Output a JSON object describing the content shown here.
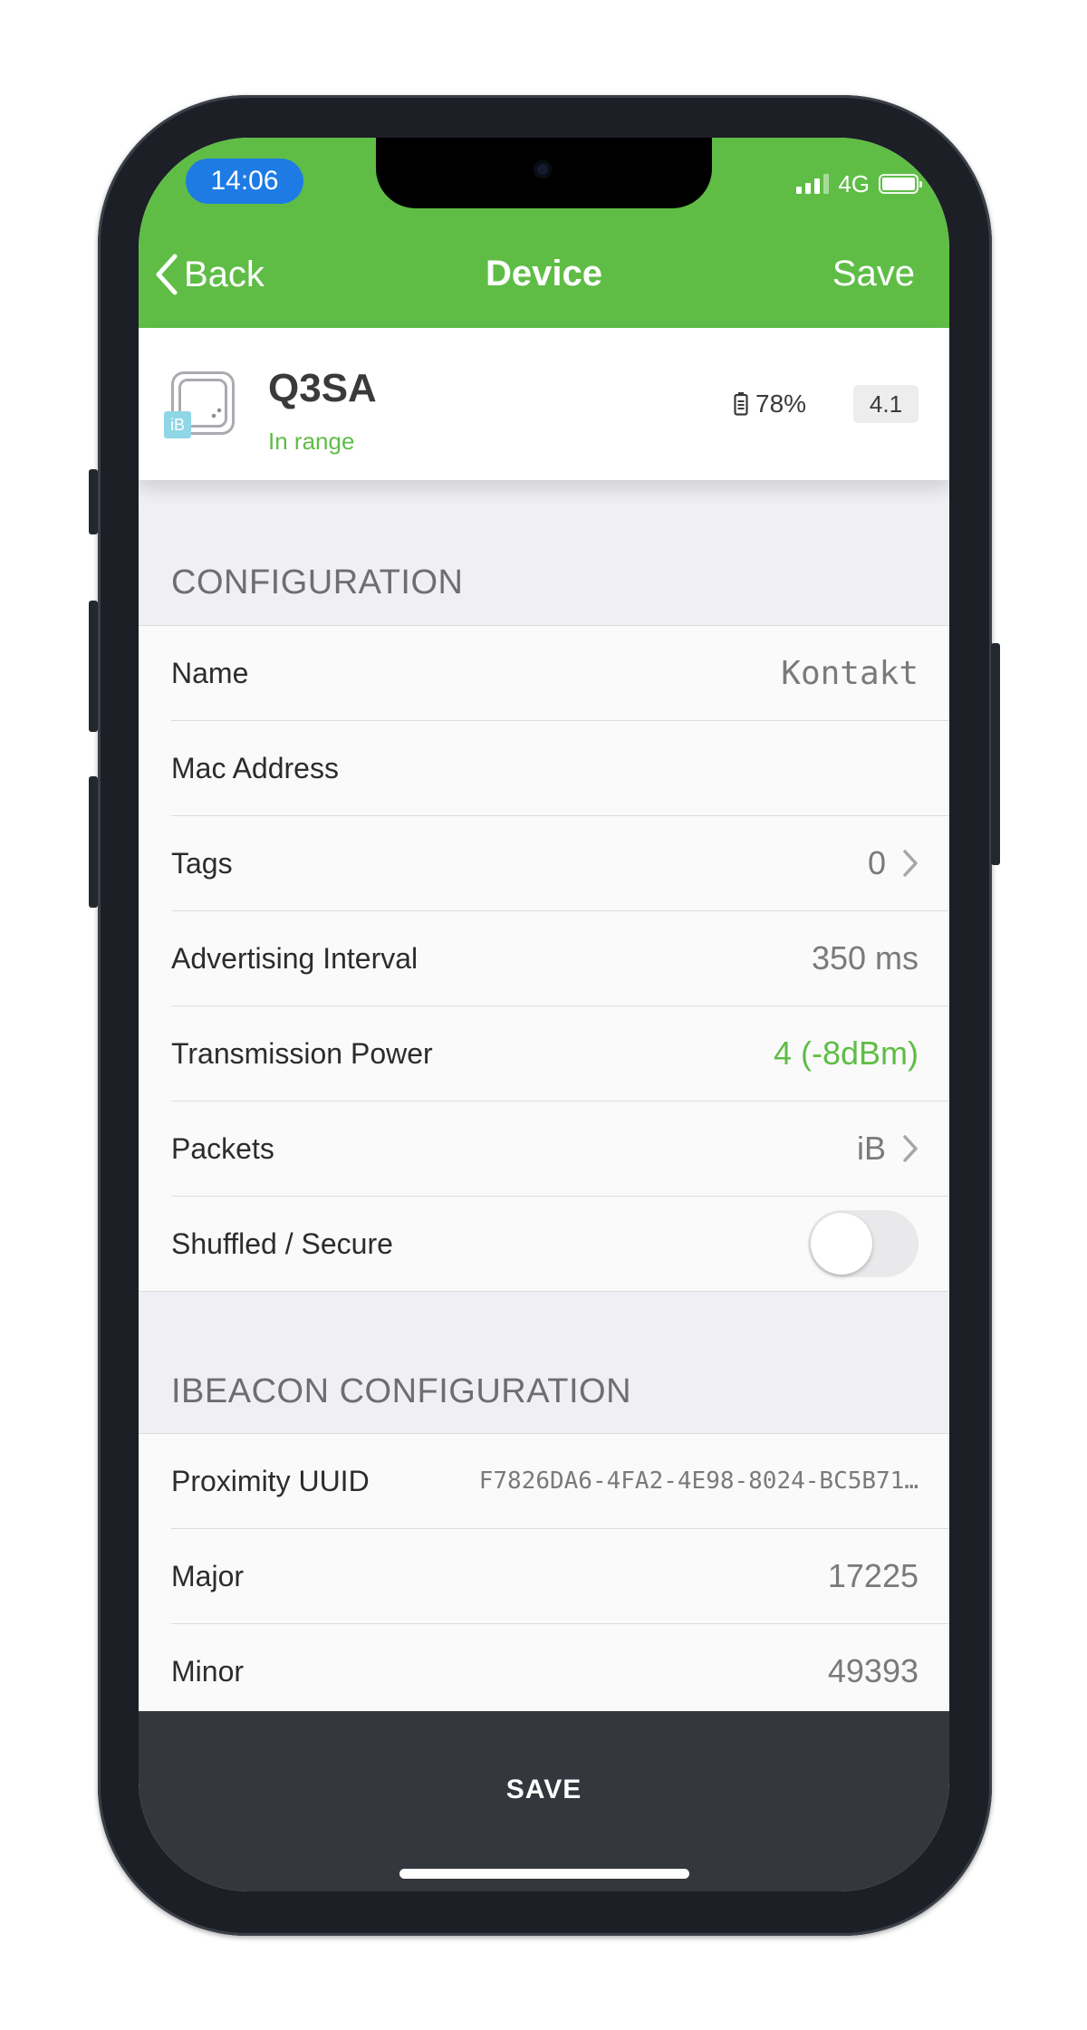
{
  "status_bar": {
    "time": "14:06",
    "network": "4G",
    "icons": [
      "signal-bars-icon",
      "battery-icon"
    ]
  },
  "nav": {
    "back_label": "Back",
    "title": "Device",
    "save_label": "Save"
  },
  "device": {
    "name": "Q3SA",
    "status": "In range",
    "badge": "iB",
    "battery": "78%",
    "firmware": "4.1"
  },
  "configuration": {
    "header": "CONFIGURATION",
    "rows": [
      {
        "label": "Name",
        "value": "Kontakt"
      },
      {
        "label": "Mac Address",
        "value": ""
      },
      {
        "label": "Tags",
        "value": "0"
      },
      {
        "label": "Advertising Interval",
        "value": "350 ms"
      },
      {
        "label": "Transmission Power",
        "value": "4 (-8dBm)"
      },
      {
        "label": "Packets",
        "value": "iB"
      },
      {
        "label": "Shuffled / Secure",
        "toggle_on": false
      }
    ]
  },
  "ibeacon": {
    "header": "IBEACON CONFIGURATION",
    "rows": [
      {
        "label": "Proximity UUID",
        "value": "F7826DA6-4FA2-4E98-8024-BC5B71…"
      },
      {
        "label": "Major",
        "value": "17225"
      },
      {
        "label": "Minor",
        "value": "49393"
      }
    ]
  },
  "footer": {
    "save_label": "SAVE"
  },
  "colors": {
    "accent_green": "#5fbd46",
    "time_pill_blue": "#1e7be4",
    "footer_bg": "#34373d"
  }
}
